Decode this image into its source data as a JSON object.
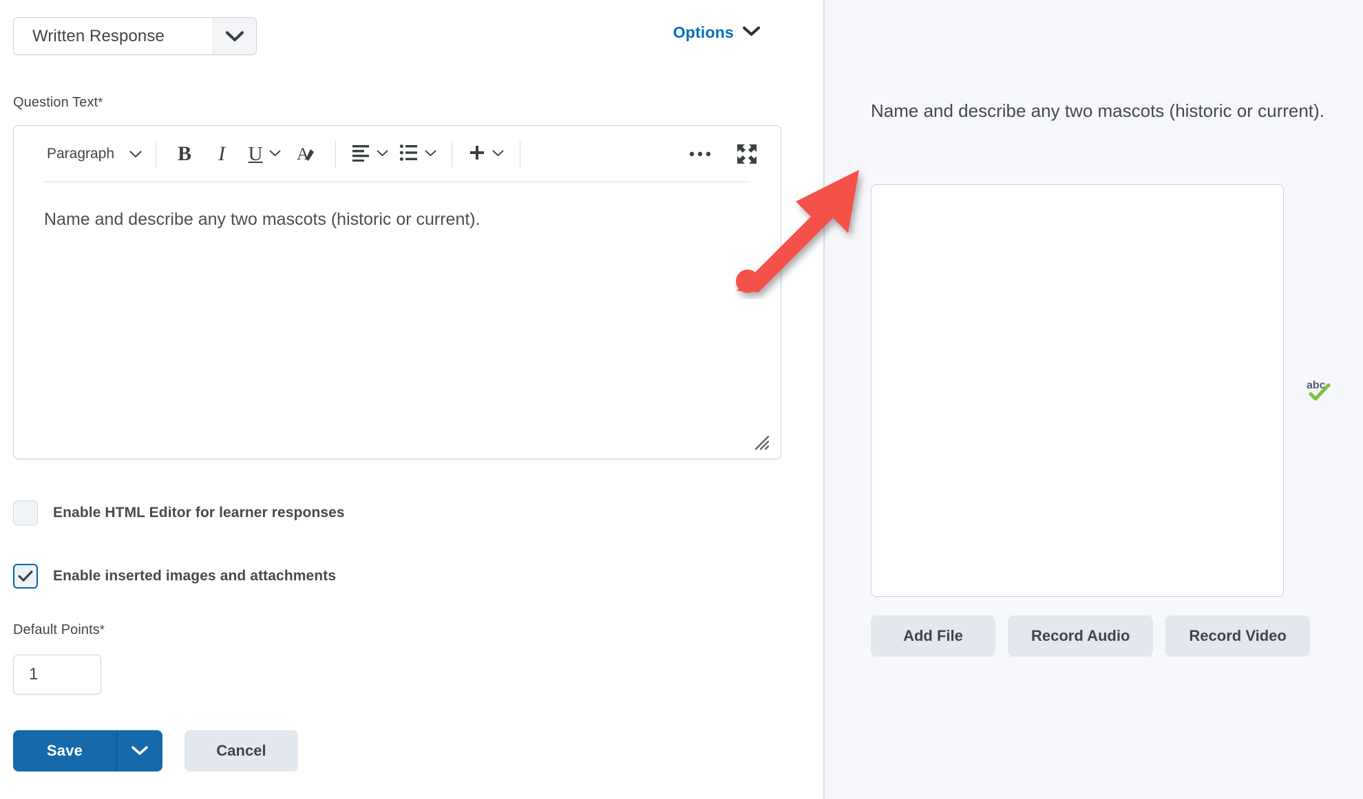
{
  "question_type": {
    "label": "Written Response",
    "chevron_icon": "chevron-down-icon"
  },
  "options": {
    "label": "Options",
    "chevron_icon": "chevron-down-icon",
    "color": "#006FBF"
  },
  "question_text": {
    "label": "Question Text",
    "required_marker": "*",
    "value": "Name and describe any two mascots (historic or current)."
  },
  "editor_toolbar": {
    "paragraph_label": "Paragraph",
    "paragraph_chevron": "chevron-down-icon",
    "bold_label": "B",
    "italic_label": "I",
    "underline_label": "U",
    "underline_chevron": "chevron-down-icon",
    "clear_format_icon": "clear-formatting-icon",
    "align_icon": "align-left-icon",
    "align_chevron": "chevron-down-icon",
    "list_icon": "bulleted-list-icon",
    "list_chevron": "chevron-down-icon",
    "insert_label": "+",
    "insert_chevron": "chevron-down-icon",
    "more_label": "•••",
    "fullscreen_icon": "expand-fullscreen-icon",
    "resize_grip_icon": "resize-grip-icon"
  },
  "checkboxes": [
    {
      "label": "Enable HTML Editor for learner responses",
      "checked": false
    },
    {
      "label": "Enable inserted images and attachments",
      "checked": true
    }
  ],
  "default_points": {
    "label": "Default Points",
    "required_marker": "*",
    "value": "1"
  },
  "footer": {
    "save_label": "Save",
    "save_chevron": "chevron-down-icon",
    "cancel_label": "Cancel",
    "save_color": "#1569AB"
  },
  "preview": {
    "question": "Name and describe any two mascots (historic or current).",
    "answer_value": "",
    "spellcheck_icon": "spellcheck-abc-icon",
    "spellcheck_text": "abc",
    "buttons": [
      {
        "label": "Add File"
      },
      {
        "label": "Record Audio"
      },
      {
        "label": "Record Video"
      }
    ]
  },
  "annotation": {
    "arrow_icon": "red-arrow-pointing-up-right",
    "color": "#F4514A"
  }
}
